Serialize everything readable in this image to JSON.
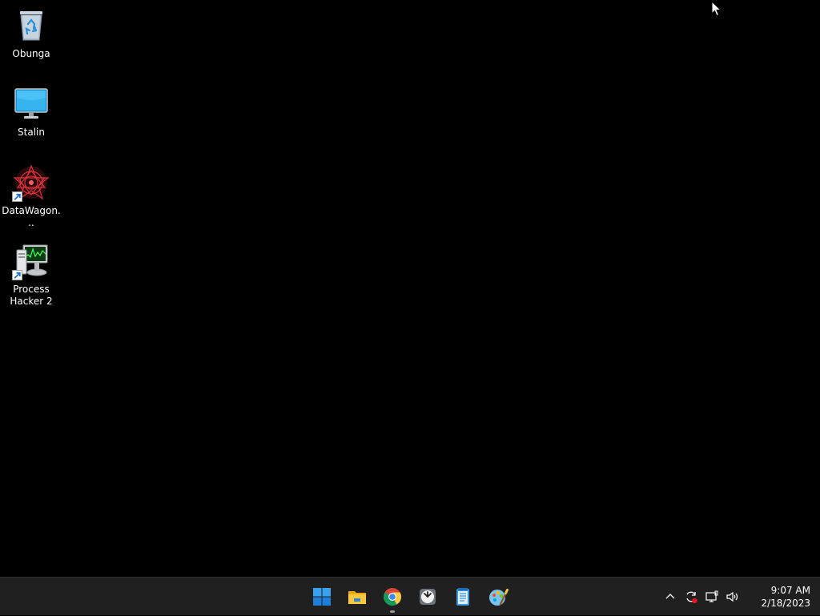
{
  "desktop": {
    "background_color": "#000000",
    "icons": [
      {
        "label": "Obunga",
        "icon": "recycle-bin-icon"
      },
      {
        "label": "Stalin",
        "icon": "monitor-icon"
      },
      {
        "label": "DataWagon...",
        "icon": "datawagon-icon",
        "shortcut": true
      },
      {
        "label": "Process Hacker 2",
        "icon": "process-hacker-icon",
        "shortcut": true
      }
    ]
  },
  "taskbar": {
    "background_color": "#202020",
    "apps": [
      {
        "name": "start",
        "icon": "windows-start-icon"
      },
      {
        "name": "file-explorer",
        "icon": "folder-icon"
      },
      {
        "name": "chrome",
        "icon": "chrome-icon",
        "running": true
      },
      {
        "name": "clock",
        "icon": "clock-icon"
      },
      {
        "name": "notepad",
        "icon": "notepad-icon"
      },
      {
        "name": "paint",
        "icon": "paint-icon"
      }
    ],
    "tray": {
      "icons": [
        "chevron-up-icon",
        "sync-icon",
        "network-icon",
        "volume-icon"
      ],
      "time": "9:07 AM",
      "date": "2/18/2023"
    }
  }
}
